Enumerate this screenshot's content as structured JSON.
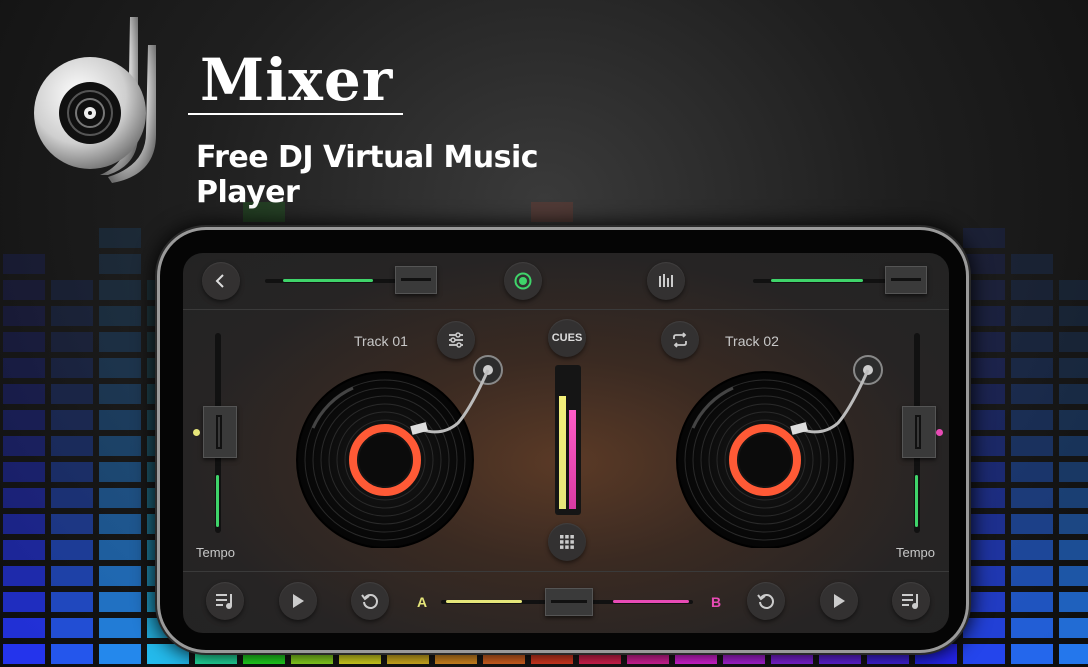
{
  "branding": {
    "app_name": "Mixer",
    "tagline": "Free DJ Virtual Music Player",
    "logo_icon": "dj-vinyl-logo"
  },
  "colors": {
    "deck_a_accent": "#e6e67a",
    "deck_b_accent": "#e84bb5",
    "green_level": "#3fd46a",
    "platter_ring": "#ff5a36"
  },
  "top_bar": {
    "back_icon": "chevron-left-icon",
    "record_icon": "record-dot-icon",
    "equalizer_icon": "equalizer-bars-icon"
  },
  "deck_a": {
    "track_name": "Track 01",
    "tempo_label": "Tempo",
    "settings_icon": "sliders-icon",
    "volume_level": 0.75,
    "tempo_level": 0.5
  },
  "deck_b": {
    "track_name": "Track 02",
    "tempo_label": "Tempo",
    "sync_icon": "repeat-icon",
    "volume_level": 0.75,
    "tempo_level": 0.5
  },
  "center": {
    "cues_label": "CUES",
    "grid_icon": "grid-icon",
    "meter_a": 0.82,
    "meter_b": 0.72
  },
  "bottom_bar": {
    "crossfader_left_label": "A",
    "crossfader_right_label": "B",
    "crossfader_position": 0.5,
    "playlist_icon": "playlist-icon",
    "play_icon": "play-icon",
    "reset_icon": "undo-icon"
  }
}
